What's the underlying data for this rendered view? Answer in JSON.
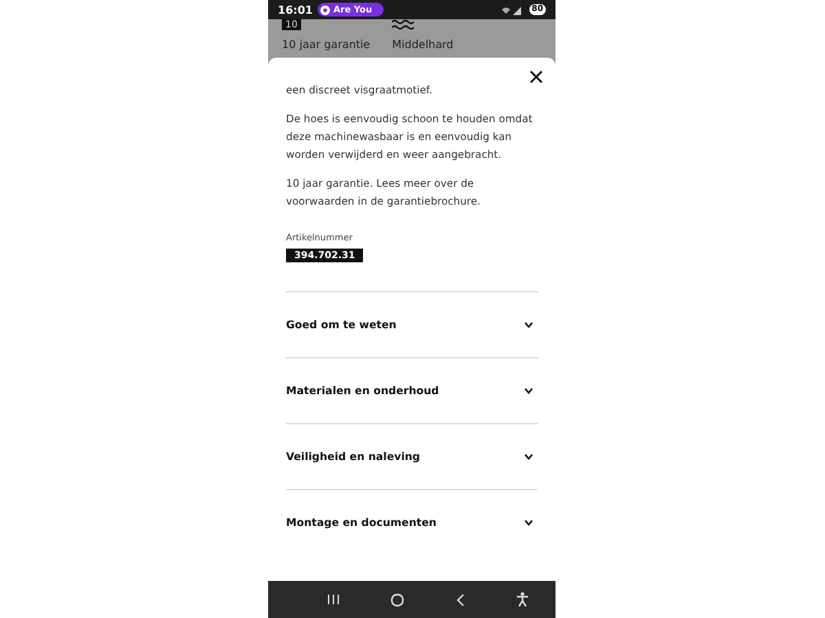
{
  "status_bar": {
    "time": "16:01",
    "media_pill": "Are You",
    "battery": "80"
  },
  "backdrop": {
    "features": [
      {
        "kind": "badge",
        "icon_text": "10",
        "label": "10 jaar garantie"
      },
      {
        "kind": "waves",
        "label": "Middelhard"
      }
    ]
  },
  "sheet": {
    "paragraphs": [
      "een discreet visgraatmotief.",
      "De hoes is eenvoudig schoon te houden omdat deze machinewasbaar is en eenvoudig kan worden verwijderd en weer aangebracht.",
      "10 jaar garantie. Lees meer over de voorwaarden in de garantiebrochure."
    ],
    "article_label": "Artikelnummer",
    "article_number": "394.702.31",
    "sections": [
      {
        "title": "Goed om te weten",
        "expanded": false
      },
      {
        "title": "Materialen en onderhoud",
        "expanded": false
      },
      {
        "title": "Veiligheid en naleving",
        "expanded": false
      },
      {
        "title": "Montage en documenten",
        "expanded": false
      }
    ]
  }
}
